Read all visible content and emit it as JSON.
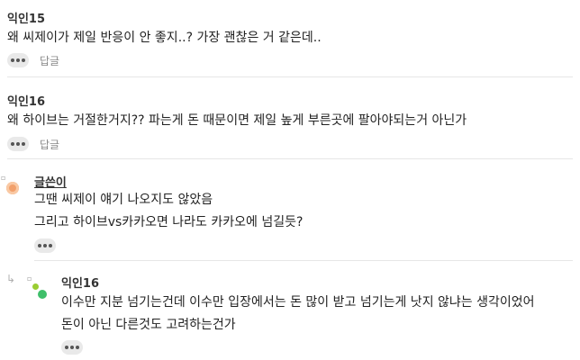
{
  "comments": [
    {
      "author": "익인15",
      "lines": [
        "왜 씨제이가 제일 반응이 안 좋지..? 가장 괜찮은 거 같은데.."
      ],
      "more_icon": "more-dots-icon",
      "reply_label": "답글"
    },
    {
      "author": "익인16",
      "lines": [
        "왜 하이브는 거절한거지?? 파는게 돈 때문이면 제일 높게 부른곳에 팔아야되는거 아닌가"
      ],
      "more_icon": "more-dots-icon",
      "reply_label": "답글"
    },
    {
      "author": "글쓴이",
      "lines": [
        "그땐 씨제이 얘기 나오지도 않았음",
        "그리고 하이브vs카카오면 나라도 카카오에 넘길듯?"
      ],
      "more_icon": "more-dots-icon"
    },
    {
      "author": "익인16",
      "lines": [
        "이수만 지분 넘기는건데 이수만 입장에서는 돈 많이 받고 넘기는게 낫지 않냐는 생각이었어",
        "돈이 아닌 다른것도 고려하는건가"
      ],
      "more_icon": "more-dots-icon"
    }
  ],
  "colors": {
    "author_avatar": "#f2a06b",
    "reply_avatar_main": "#3fbf6a",
    "reply_avatar_small": "#9acd32",
    "reply_arrow": "#b0b0b0"
  }
}
